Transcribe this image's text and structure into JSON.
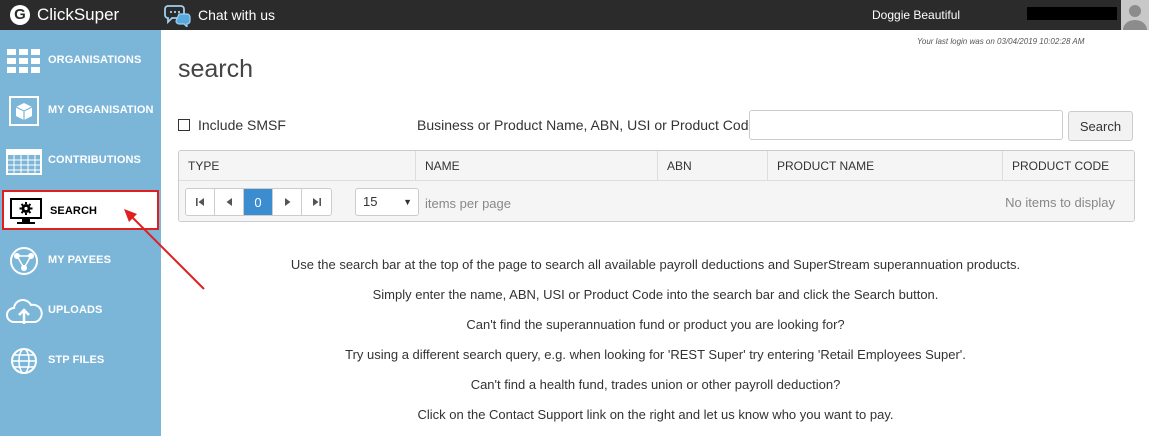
{
  "header": {
    "logo_mark": "G",
    "logo_text": "ClickSuper",
    "chat_label": "Chat with us",
    "username": "Doggie Beautiful"
  },
  "sidebar": {
    "items": [
      {
        "label": "ORGANISATIONS",
        "icon": "organisations-grid-icon"
      },
      {
        "label": "MY ORGANISATION",
        "icon": "cube-box-icon"
      },
      {
        "label": "CONTRIBUTIONS",
        "icon": "calendar-icon"
      },
      {
        "label": "SEARCH",
        "icon": "monitor-gear-icon",
        "active": true
      },
      {
        "label": "MY PAYEES",
        "icon": "network-globe-icon"
      },
      {
        "label": "UPLOADS",
        "icon": "cloud-upload-icon"
      },
      {
        "label": "STP FILES",
        "icon": "globe-icon"
      }
    ]
  },
  "main": {
    "last_login": "Your last login was on 03/04/2019 10:02:28 AM",
    "title": "search",
    "include_smsf_label": "Include SMSF",
    "search_label": "Business or Product Name, ABN, USI or Product Code",
    "search_value": "",
    "search_button": "Search"
  },
  "grid": {
    "columns": [
      "TYPE",
      "NAME",
      "ABN",
      "PRODUCT NAME",
      "PRODUCT CODE"
    ],
    "current_page": "0",
    "page_size": "15",
    "items_per_page": "items per page",
    "no_items": "No items to display"
  },
  "help": {
    "lines": [
      "Use the search bar at the top of the page to search all available payroll deductions and SuperStream superannuation products.",
      "Simply enter the name, ABN, USI or Product Code into the search bar and click the Search button.",
      "Can't find the superannuation fund or product you are looking for?",
      "Try using a different search query, e.g. when looking for 'REST Super' try entering 'Retail Employees Super'.",
      "Can't find a health fund, trades union or other payroll deduction?",
      "Click on the Contact Support link on the right and let us know who you want to pay."
    ]
  },
  "colors": {
    "topbar": "#2b2b2b",
    "sidebar": "#7bb6d9",
    "highlight": "#e02020",
    "pager_current": "#3c8dd0"
  }
}
